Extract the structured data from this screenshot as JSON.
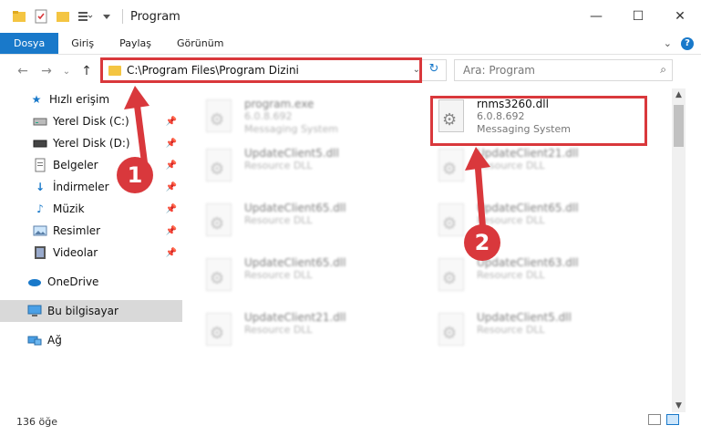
{
  "window": {
    "title": "Program",
    "minimize": "—",
    "maximize": "☐",
    "close": "✕"
  },
  "ribbon": {
    "tabs": [
      "Dosya",
      "Giriş",
      "Paylaş",
      "Görünüm"
    ],
    "help": "?"
  },
  "nav": {
    "back": "←",
    "forward": "→",
    "recent": "⌄",
    "up": "↑",
    "address": "C:\\Program Files\\Program Dizini",
    "search_placeholder": "Ara: Program"
  },
  "sidebar": {
    "items": [
      {
        "label": "Hızlı erişim",
        "icon": "star-icon",
        "pinned": false
      },
      {
        "label": "Yerel Disk (C:)",
        "icon": "drive-icon",
        "pinned": true
      },
      {
        "label": "Yerel Disk (D:)",
        "icon": "drive-icon",
        "pinned": true
      },
      {
        "label": "Belgeler",
        "icon": "document-icon",
        "pinned": true
      },
      {
        "label": "İndirmeler",
        "icon": "download-icon",
        "pinned": true
      },
      {
        "label": "Müzik",
        "icon": "music-icon",
        "pinned": true
      },
      {
        "label": "Resimler",
        "icon": "pictures-icon",
        "pinned": true
      },
      {
        "label": "Videolar",
        "icon": "video-icon",
        "pinned": true
      },
      {
        "label": "OneDrive",
        "icon": "cloud-icon",
        "pinned": false
      },
      {
        "label": "Bu bilgisayar",
        "icon": "computer-icon",
        "pinned": false
      },
      {
        "label": "Ağ",
        "icon": "network-icon",
        "pinned": false
      }
    ]
  },
  "files": [
    {
      "name": "program.exe",
      "line2": "6.0.8.692",
      "line3": "Messaging System"
    },
    {
      "name": "rnms3260.dll",
      "line2": "6.0.8.692",
      "line3": "Messaging System"
    },
    {
      "name": "UpdateClient5.dll",
      "line2": "Resource DLL"
    },
    {
      "name": "UpdateClient21.dll",
      "line2": "Resource DLL"
    },
    {
      "name": "UpdateClient65.dll",
      "line2": "Resource DLL"
    },
    {
      "name": "UpdateClient65.dll",
      "line2": "Resource DLL"
    },
    {
      "name": "UpdateClient65.dll",
      "line2": "Resource DLL"
    },
    {
      "name": "UpdateClient63.dll",
      "line2": "Resource DLL"
    },
    {
      "name": "UpdateClient21.dll",
      "line2": "Resource DLL"
    },
    {
      "name": "UpdateClient5.dll",
      "line2": "Resource DLL"
    }
  ],
  "status": {
    "count": "136 öğe"
  },
  "annotations": {
    "marker1": "1",
    "marker2": "2"
  },
  "colors": {
    "accent": "#1979ca",
    "highlight": "#d9383c"
  }
}
